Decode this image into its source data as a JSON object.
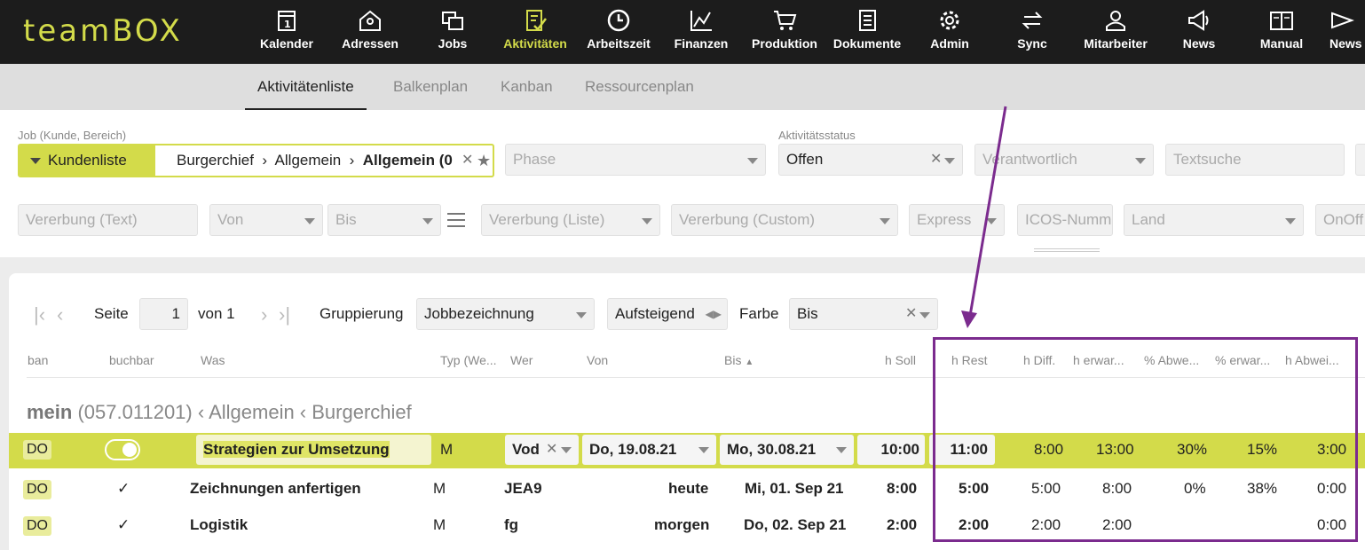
{
  "app": {
    "logo": "teamBOX"
  },
  "nav": [
    {
      "label": "Kalender",
      "icon": "calendar-icon"
    },
    {
      "label": "Adressen",
      "icon": "location-house-icon"
    },
    {
      "label": "Jobs",
      "icon": "folders-icon"
    },
    {
      "label": "Aktivitäten",
      "icon": "checklist-icon"
    },
    {
      "label": "Arbeitszeit",
      "icon": "clock-icon"
    },
    {
      "label": "Finanzen",
      "icon": "chart-icon"
    },
    {
      "label": "Produktion",
      "icon": "cart-icon"
    },
    {
      "label": "Dokumente",
      "icon": "document-icon"
    },
    {
      "label": "Admin",
      "icon": "gear-icon"
    },
    {
      "label": "Sync",
      "icon": "sync-icon"
    },
    {
      "label": "Mitarbeiter",
      "icon": "user-icon"
    },
    {
      "label": "News",
      "icon": "megaphone-icon"
    },
    {
      "label": "Manual",
      "icon": "manual-icon"
    },
    {
      "label": "News",
      "icon": "mail-icon"
    }
  ],
  "colors": {
    "accent": "#d3db4a",
    "annotation": "#7b2b8e",
    "topbar": "#1c1c1c"
  },
  "subtabs": [
    "Aktivitätenliste",
    "Balkenplan",
    "Kanban",
    "Ressourcenplan"
  ],
  "filters": {
    "job_label": "Job (Kunde, Bereich)",
    "job_button": "Kundenliste",
    "job_path": "Burgerchief  ›  Allgemein  ›  ",
    "job_path_bold": "Allgemein (0",
    "phase": "Phase",
    "status_label": "Aktivitätsstatus",
    "status": "Offen",
    "verantwortlich": "Verantwortlich",
    "textsuche": "Textsuche",
    "vererbung_text": "Vererbung (Text)",
    "von": "Von",
    "bis": "Bis",
    "vererbung_liste": "Vererbung (Liste)",
    "vererbung_custom": "Vererbung (Custom)",
    "express": "Express",
    "icos": "ICOS-Numm",
    "land": "Land",
    "onoff": "OnOff"
  },
  "pager": {
    "seite": "Seite",
    "page": "1",
    "von": "von 1",
    "gruppierung": "Gruppierung",
    "gruppierung_value": "Jobbezeichnung",
    "sort": "Aufsteigend",
    "farbe": "Farbe",
    "farbe_value": "Bis"
  },
  "columns": [
    "ban",
    "buchbar",
    "Was",
    "Typ (We...",
    "Wer",
    "Von",
    "Bis",
    "h Soll",
    "h Rest",
    "h Diff.",
    "h erwar...",
    "% Abwe...",
    "% erwar...",
    "h Abwei..."
  ],
  "group": {
    "name": "mein",
    "code": "(057.011201)",
    "path": "‹ Allgemein ‹ Burgerchief"
  },
  "rows": [
    {
      "status": "DO",
      "buchbar": "",
      "was": "Strategien zur Umsetzung",
      "typ": "M",
      "wer": "Vod",
      "von": "Do, 19.08.21",
      "bis": "Mo, 30.08.21",
      "soll": "10:00",
      "rest": "11:00",
      "diff": "8:00",
      "erwar": "13:00",
      "abw_pct": "30%",
      "erwar_pct": "15%",
      "abw_h": "3:00"
    },
    {
      "status": "DO",
      "buchbar": "✓",
      "was": "Zeichnungen anfertigen",
      "typ": "M",
      "wer": "JEA9",
      "von": "heute",
      "bis": "Mi, 01. Sep 21",
      "soll": "8:00",
      "rest": "5:00",
      "diff": "5:00",
      "erwar": "8:00",
      "abw_pct": "0%",
      "erwar_pct": "38%",
      "abw_h": "0:00"
    },
    {
      "status": "DO",
      "buchbar": "✓",
      "was": "Logistik",
      "typ": "M",
      "wer": "fg",
      "von": "morgen",
      "bis": "Do, 02. Sep 21",
      "soll": "2:00",
      "rest": "2:00",
      "diff": "2:00",
      "erwar": "2:00",
      "abw_pct": "",
      "erwar_pct": "",
      "abw_h": "0:00"
    }
  ]
}
